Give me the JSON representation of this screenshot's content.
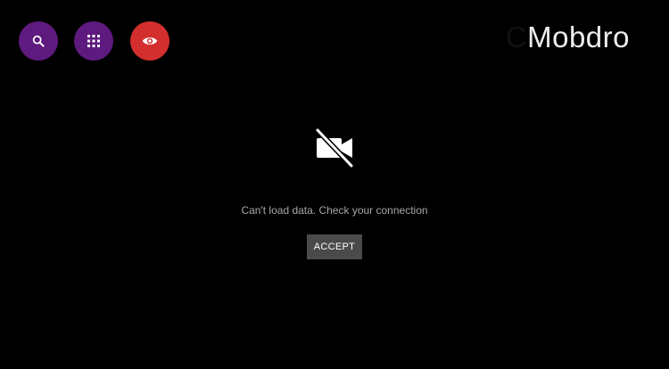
{
  "colors": {
    "search_button_bg": "#5e1a7e",
    "apps_button_bg": "#5e1a7e",
    "eye_button_bg": "#d32f2f",
    "accept_button_bg": "#4a4a4a"
  },
  "toolbar": {
    "search_icon": "search-icon",
    "apps_icon": "apps-grid-icon",
    "eye_icon": "eye-icon"
  },
  "brand": {
    "leading_letter": "C",
    "name": "Mobdro"
  },
  "status": {
    "icon": "videocam-off-icon",
    "message": "Can't load data. Check your connection"
  },
  "dialog": {
    "accept_label": "ACCEPT"
  }
}
